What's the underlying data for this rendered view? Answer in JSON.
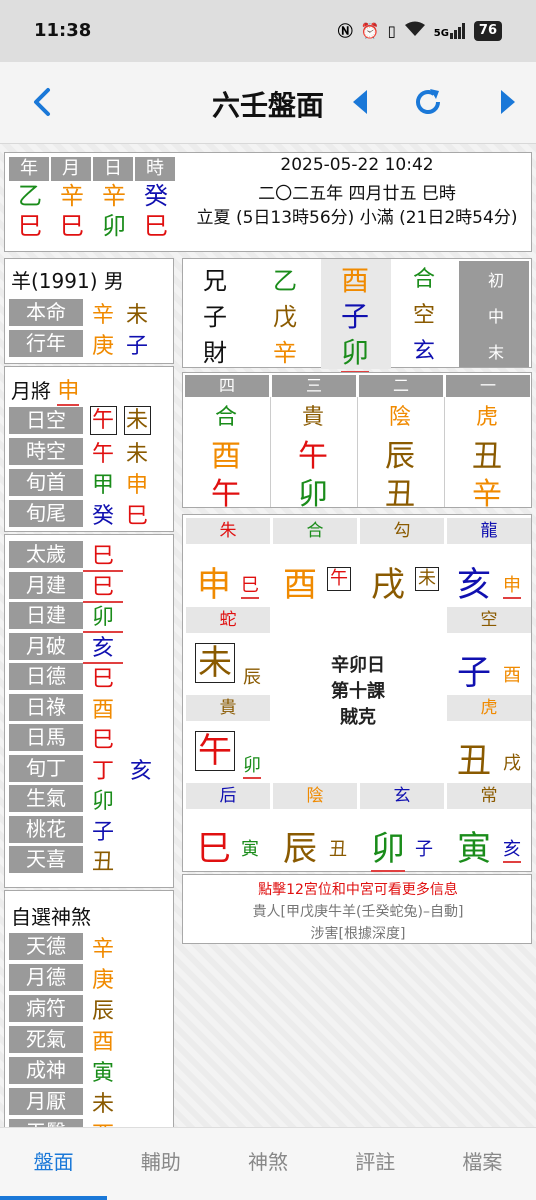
{
  "status": {
    "time": "11:38",
    "network": "5G",
    "battery": "76"
  },
  "nav": {
    "title": "六壬盤面"
  },
  "pillars": {
    "headers": [
      "年",
      "月",
      "日",
      "時"
    ],
    "stems": [
      "乙",
      "辛",
      "辛",
      "癸"
    ],
    "branches": [
      "巳",
      "巳",
      "卯",
      "巳"
    ]
  },
  "date": {
    "gregorian": "2025-05-22 10:42",
    "lunar": "二〇二五年 四月廿五 巳時",
    "terms": "立夏 (5日13時56分) 小滿 (21日2時54分)"
  },
  "person": {
    "title": "羊(1991) 男",
    "rows": [
      {
        "label": "本命",
        "a": "辛",
        "b": "未"
      },
      {
        "label": "行年",
        "a": "庚",
        "b": "子"
      }
    ]
  },
  "yuejiang": {
    "title": "月將",
    "value": "申",
    "rows": [
      {
        "label": "日空",
        "a": "午",
        "b": "未"
      },
      {
        "label": "時空",
        "a": "午",
        "b": "未"
      },
      {
        "label": "旬首",
        "a": "甲",
        "b": "申"
      },
      {
        "label": "旬尾",
        "a": "癸",
        "b": "巳"
      }
    ]
  },
  "shensha": [
    {
      "label": "太歲",
      "a": "巳"
    },
    {
      "label": "月建",
      "a": "巳"
    },
    {
      "label": "日建",
      "a": "卯"
    },
    {
      "label": "月破",
      "a": "亥"
    },
    {
      "label": "日德",
      "a": "巳"
    },
    {
      "label": "日祿",
      "a": "酉"
    },
    {
      "label": "日馬",
      "a": "巳"
    },
    {
      "label": "旬丁",
      "a": "丁",
      "b": "亥"
    },
    {
      "label": "生氣",
      "a": "卯"
    },
    {
      "label": "桃花",
      "a": "子"
    },
    {
      "label": "天喜",
      "a": "丑"
    }
  ],
  "custom": {
    "title": "自選神煞",
    "rows": [
      {
        "label": "天德",
        "a": "辛"
      },
      {
        "label": "月德",
        "a": "庚"
      },
      {
        "label": "病符",
        "a": "辰"
      },
      {
        "label": "死氣",
        "a": "酉"
      },
      {
        "label": "成神",
        "a": "寅"
      },
      {
        "label": "月厭",
        "a": "未"
      },
      {
        "label": "天醫",
        "a": "酉"
      }
    ]
  },
  "sanchuan": {
    "liuqin": [
      "兄",
      "子",
      "財"
    ],
    "dungan": [
      "乙",
      "戊",
      "辛"
    ],
    "branch": [
      "酉",
      "子",
      "卯"
    ],
    "jiang": [
      "合",
      "空",
      "玄"
    ],
    "stage": [
      "初",
      "中",
      "末"
    ]
  },
  "sike": {
    "headers": [
      "四",
      "三",
      "二",
      "一"
    ],
    "jiang": [
      "合",
      "貴",
      "陰",
      "虎"
    ],
    "upper": [
      "酉",
      "午",
      "辰",
      "丑"
    ],
    "lower": [
      "午",
      "卯",
      "丑",
      "辛"
    ]
  },
  "plate": {
    "top": [
      {
        "jiang": "朱",
        "main": "申",
        "sub": "巳"
      },
      {
        "jiang": "合",
        "main": "酉",
        "sub": "午"
      },
      {
        "jiang": "勾",
        "main": "戌",
        "sub": "未"
      },
      {
        "jiang": "龍",
        "main": "亥",
        "sub": "申"
      }
    ],
    "left": [
      {
        "jiang": "蛇",
        "main": "未",
        "sub": "辰"
      },
      {
        "jiang": "貴",
        "main": "午",
        "sub": "卯"
      }
    ],
    "right": [
      {
        "jiang": "空",
        "main": "子",
        "sub": "酉"
      },
      {
        "jiang": "虎",
        "main": "丑",
        "sub": "戌"
      }
    ],
    "bottom": [
      {
        "jiang": "后",
        "main": "巳",
        "sub": "寅"
      },
      {
        "jiang": "陰",
        "main": "辰",
        "sub": "丑"
      },
      {
        "jiang": "玄",
        "main": "卯",
        "sub": "子"
      },
      {
        "jiang": "常",
        "main": "寅",
        "sub": "亥"
      }
    ],
    "center": [
      "辛卯日",
      "第十課",
      "賊克"
    ]
  },
  "notes": {
    "hint": "點擊12宮位和中宮可看更多信息",
    "guiren": "貴人[甲戊庚牛羊(壬癸蛇兔)–自動]",
    "shehai": "涉害[根據深度]"
  },
  "tabs": [
    "盤面",
    "輔助",
    "神煞",
    "評註",
    "檔案"
  ]
}
